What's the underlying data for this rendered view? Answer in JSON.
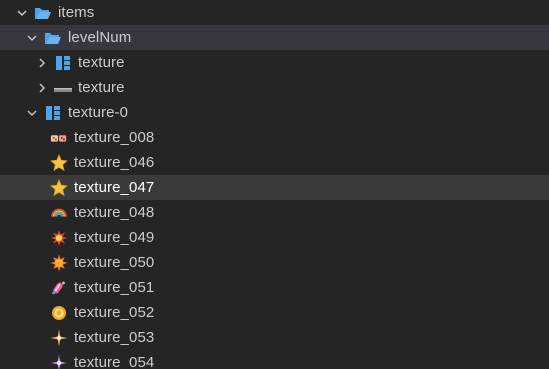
{
  "tree": {
    "items": [
      {
        "label": "items",
        "icon": "folder-open-icon",
        "expanded": true
      },
      {
        "label": "levelNum",
        "icon": "folder-open-icon",
        "expanded": true
      },
      {
        "label": "texture",
        "icon": "sprite-node-icon",
        "expanded": false
      },
      {
        "label": "texture",
        "icon": "bar-texture-icon",
        "expanded": false
      },
      {
        "label": "texture-0",
        "icon": "sprite-node-icon",
        "expanded": true
      },
      {
        "label": "texture_008",
        "icon": "dice-texture-icon"
      },
      {
        "label": "texture_046",
        "icon": "star-texture-icon"
      },
      {
        "label": "texture_047",
        "icon": "star-texture-icon",
        "selected": true
      },
      {
        "label": "texture_048",
        "icon": "rainbow-texture-icon"
      },
      {
        "label": "texture_049",
        "icon": "explosion-texture-icon"
      },
      {
        "label": "texture_050",
        "icon": "sun-burst-texture-icon"
      },
      {
        "label": "texture_051",
        "icon": "candy-texture-icon"
      },
      {
        "label": "texture_052",
        "icon": "ring-texture-icon"
      },
      {
        "label": "texture_053",
        "icon": "sparkle-texture-icon"
      },
      {
        "label": "texture_054",
        "icon": "purple-sparkle-texture-icon"
      }
    ]
  },
  "colors": {
    "background": "#252526",
    "hover_row": "#37373d",
    "selected_row": "#3a3a3a",
    "text": "#cccccc",
    "folder": "#4fa3e8"
  }
}
